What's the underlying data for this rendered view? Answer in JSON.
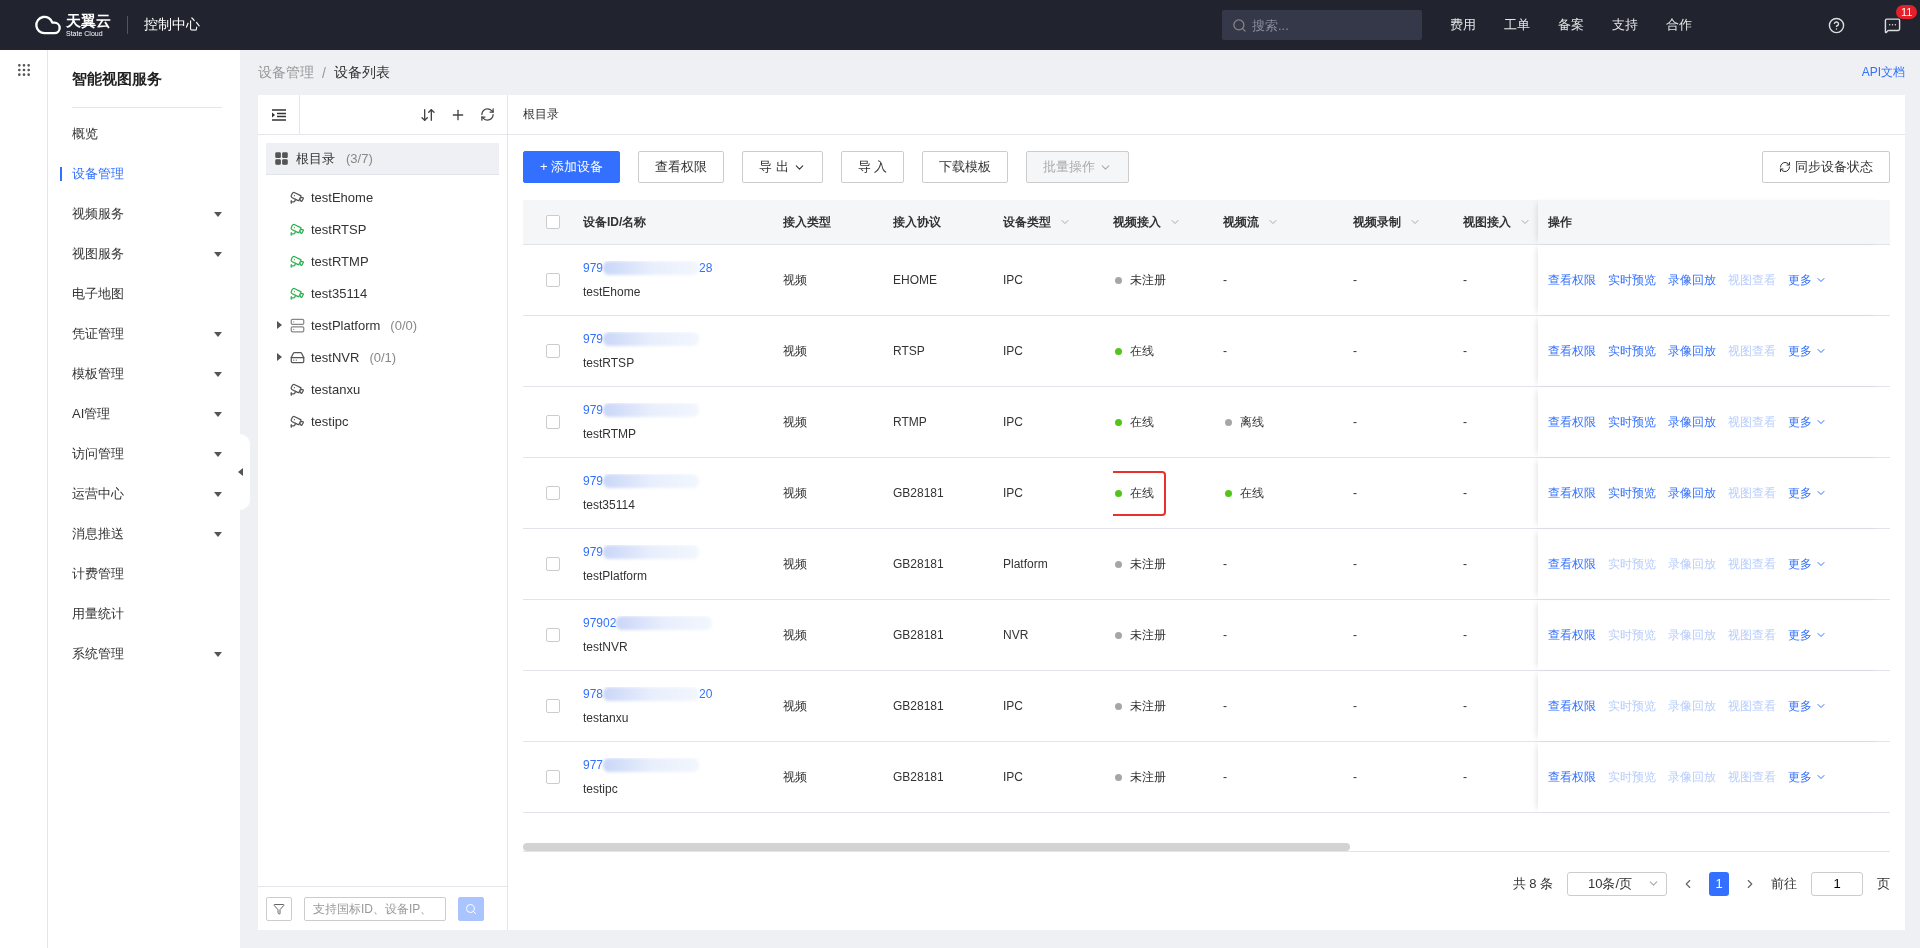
{
  "topbar": {
    "brand": "天翼云",
    "brand_sub": "State Cloud",
    "console": "控制中心",
    "search": {
      "placeholder": "搜索..."
    },
    "links": [
      "费用",
      "工单",
      "备案",
      "支持",
      "合作"
    ],
    "notification_count": "11"
  },
  "sidebar": {
    "title": "智能视图服务",
    "items": [
      {
        "label": "概览",
        "selected": false,
        "expandable": false
      },
      {
        "label": "设备管理",
        "selected": true,
        "expandable": false
      },
      {
        "label": "视频服务",
        "selected": false,
        "expandable": true
      },
      {
        "label": "视图服务",
        "selected": false,
        "expandable": true
      },
      {
        "label": "电子地图",
        "selected": false,
        "expandable": false
      },
      {
        "label": "凭证管理",
        "selected": false,
        "expandable": true
      },
      {
        "label": "模板管理",
        "selected": false,
        "expandable": true
      },
      {
        "label": "AI管理",
        "selected": false,
        "expandable": true
      },
      {
        "label": "访问管理",
        "selected": false,
        "expandable": true
      },
      {
        "label": "运营中心",
        "selected": false,
        "expandable": true
      },
      {
        "label": "消息推送",
        "selected": false,
        "expandable": true
      },
      {
        "label": "计费管理",
        "selected": false,
        "expandable": false
      },
      {
        "label": "用量统计",
        "selected": false,
        "expandable": false
      },
      {
        "label": "系统管理",
        "selected": false,
        "expandable": true
      }
    ]
  },
  "breadcrumb": {
    "items": [
      "设备管理",
      "设备列表"
    ],
    "separator": "/"
  },
  "api_link": "API文档",
  "tree": {
    "root": {
      "label": "根目录",
      "count": "(3/7)",
      "selected": true
    },
    "items": [
      {
        "label": "testEhome",
        "kind": "camera",
        "online": false,
        "expandable": false
      },
      {
        "label": "testRTSP",
        "kind": "camera",
        "online": true,
        "expandable": false
      },
      {
        "label": "testRTMP",
        "kind": "camera",
        "online": true,
        "expandable": false
      },
      {
        "label": "test35114",
        "kind": "camera",
        "online": true,
        "expandable": false
      },
      {
        "label": "testPlatform",
        "count": "(0/0)",
        "kind": "platform",
        "online": false,
        "expandable": true
      },
      {
        "label": "testNVR",
        "count": "(0/1)",
        "kind": "nvr",
        "online": false,
        "expandable": true
      },
      {
        "label": "testanxu",
        "kind": "camera",
        "online": false,
        "expandable": false
      },
      {
        "label": "testipc",
        "kind": "camera",
        "online": false,
        "expandable": false
      }
    ],
    "search": {
      "placeholder": "支持国标ID、设备IP、"
    }
  },
  "panel_title": "根目录",
  "toolbar": {
    "buttons": [
      {
        "label": "+ 添加设备",
        "kind": "primary",
        "disabled": false,
        "dropdown": false
      },
      {
        "label": "查看权限",
        "kind": "default",
        "disabled": false,
        "dropdown": false
      },
      {
        "label": "导 出",
        "kind": "default",
        "disabled": false,
        "dropdown": true
      },
      {
        "label": "导 入",
        "kind": "default",
        "disabled": false,
        "dropdown": false
      },
      {
        "label": "下载模板",
        "kind": "default",
        "disabled": false,
        "dropdown": false
      },
      {
        "label": "批量操作",
        "kind": "default",
        "disabled": true,
        "dropdown": true
      }
    ],
    "sync_button": "同步设备状态"
  },
  "table": {
    "all_checked": false,
    "columns": [
      {
        "label": "设备ID/名称",
        "filter": false
      },
      {
        "label": "接入类型",
        "filter": false
      },
      {
        "label": "接入协议",
        "filter": false
      },
      {
        "label": "设备类型",
        "filter": true
      },
      {
        "label": "视频接入",
        "filter": true
      },
      {
        "label": "视频流",
        "filter": true
      },
      {
        "label": "视频录制",
        "filter": true
      },
      {
        "label": "视图接入",
        "filter": true
      },
      {
        "label": "操作",
        "filter": false
      }
    ],
    "rows": [
      {
        "checked": false,
        "id": "979",
        "id_suffix": "28",
        "name": "testEhome",
        "access_type": "视频",
        "protocol": "EHOME",
        "device_type": "IPC",
        "video_access": {
          "label": "未注册",
          "color": "#a6a6a6",
          "highlighted": false
        },
        "video_stream": {
          "label": "-"
        },
        "recording": "-",
        "view_access": "-",
        "actions": [
          {
            "label": "查看权限",
            "disabled": false
          },
          {
            "label": "实时预览",
            "disabled": false
          },
          {
            "label": "录像回放",
            "disabled": false
          },
          {
            "label": "视图查看",
            "disabled": true
          },
          {
            "label": "更多",
            "disabled": false
          }
        ]
      },
      {
        "checked": false,
        "id": "979",
        "name": "testRTSP",
        "access_type": "视频",
        "protocol": "RTSP",
        "device_type": "IPC",
        "video_access": {
          "label": "在线",
          "color": "#52c41a",
          "highlighted": false
        },
        "video_stream": {
          "label": "-"
        },
        "recording": "-",
        "view_access": "-",
        "actions": [
          {
            "label": "查看权限",
            "disabled": false
          },
          {
            "label": "实时预览",
            "disabled": false
          },
          {
            "label": "录像回放",
            "disabled": false
          },
          {
            "label": "视图查看",
            "disabled": true
          },
          {
            "label": "更多",
            "disabled": false
          }
        ]
      },
      {
        "checked": false,
        "id": "979",
        "name": "testRTMP",
        "access_type": "视频",
        "protocol": "RTMP",
        "device_type": "IPC",
        "video_access": {
          "label": "在线",
          "color": "#52c41a",
          "highlighted": false
        },
        "video_stream": {
          "label": "离线",
          "color": "#a6a6a6"
        },
        "recording": "-",
        "view_access": "-",
        "actions": [
          {
            "label": "查看权限",
            "disabled": false
          },
          {
            "label": "实时预览",
            "disabled": false
          },
          {
            "label": "录像回放",
            "disabled": false
          },
          {
            "label": "视图查看",
            "disabled": true
          },
          {
            "label": "更多",
            "disabled": false
          }
        ]
      },
      {
        "checked": false,
        "id": "979",
        "name": "test35114",
        "access_type": "视频",
        "protocol": "GB28181",
        "device_type": "IPC",
        "video_access": {
          "label": "在线",
          "color": "#52c41a",
          "highlighted": true
        },
        "video_stream": {
          "label": "在线",
          "color": "#52c41a"
        },
        "recording": "-",
        "view_access": "-",
        "actions": [
          {
            "label": "查看权限",
            "disabled": false
          },
          {
            "label": "实时预览",
            "disabled": false
          },
          {
            "label": "录像回放",
            "disabled": false
          },
          {
            "label": "视图查看",
            "disabled": true
          },
          {
            "label": "更多",
            "disabled": false
          }
        ]
      },
      {
        "checked": false,
        "id": "979",
        "name": "testPlatform",
        "access_type": "视频",
        "protocol": "GB28181",
        "device_type": "Platform",
        "video_access": {
          "label": "未注册",
          "color": "#a6a6a6",
          "highlighted": false
        },
        "video_stream": {
          "label": "-"
        },
        "recording": "-",
        "view_access": "-",
        "actions": [
          {
            "label": "查看权限",
            "disabled": false
          },
          {
            "label": "实时预览",
            "disabled": true
          },
          {
            "label": "录像回放",
            "disabled": true
          },
          {
            "label": "视图查看",
            "disabled": true
          },
          {
            "label": "更多",
            "disabled": false
          }
        ]
      },
      {
        "checked": false,
        "id": "97902",
        "name": "testNVR",
        "access_type": "视频",
        "protocol": "GB28181",
        "device_type": "NVR",
        "video_access": {
          "label": "未注册",
          "color": "#a6a6a6",
          "highlighted": false
        },
        "video_stream": {
          "label": "-"
        },
        "recording": "-",
        "view_access": "-",
        "actions": [
          {
            "label": "查看权限",
            "disabled": false
          },
          {
            "label": "实时预览",
            "disabled": true
          },
          {
            "label": "录像回放",
            "disabled": true
          },
          {
            "label": "视图查看",
            "disabled": true
          },
          {
            "label": "更多",
            "disabled": false
          }
        ]
      },
      {
        "checked": false,
        "id": "978",
        "id_suffix": "20",
        "name": "testanxu",
        "access_type": "视频",
        "protocol": "GB28181",
        "device_type": "IPC",
        "video_access": {
          "label": "未注册",
          "color": "#a6a6a6",
          "highlighted": false
        },
        "video_stream": {
          "label": "-"
        },
        "recording": "-",
        "view_access": "-",
        "actions": [
          {
            "label": "查看权限",
            "disabled": false
          },
          {
            "label": "实时预览",
            "disabled": true
          },
          {
            "label": "录像回放",
            "disabled": true
          },
          {
            "label": "视图查看",
            "disabled": true
          },
          {
            "label": "更多",
            "disabled": false
          }
        ]
      },
      {
        "checked": false,
        "id": "977",
        "name": "testipc",
        "access_type": "视频",
        "protocol": "GB28181",
        "device_type": "IPC",
        "video_access": {
          "label": "未注册",
          "color": "#a6a6a6",
          "highlighted": false
        },
        "video_stream": {
          "label": "-"
        },
        "recording": "-",
        "view_access": "-",
        "actions": [
          {
            "label": "查看权限",
            "disabled": false
          },
          {
            "label": "实时预览",
            "disabled": true
          },
          {
            "label": "录像回放",
            "disabled": true
          },
          {
            "label": "视图查看",
            "disabled": true
          },
          {
            "label": "更多",
            "disabled": false
          }
        ]
      }
    ]
  },
  "pagination": {
    "total": "共 8 条",
    "page_size": "10条/页",
    "pages": [
      {
        "label": "1",
        "selected": true
      }
    ],
    "goto_label": "前往",
    "goto_value": "1",
    "page_suffix": "页"
  }
}
